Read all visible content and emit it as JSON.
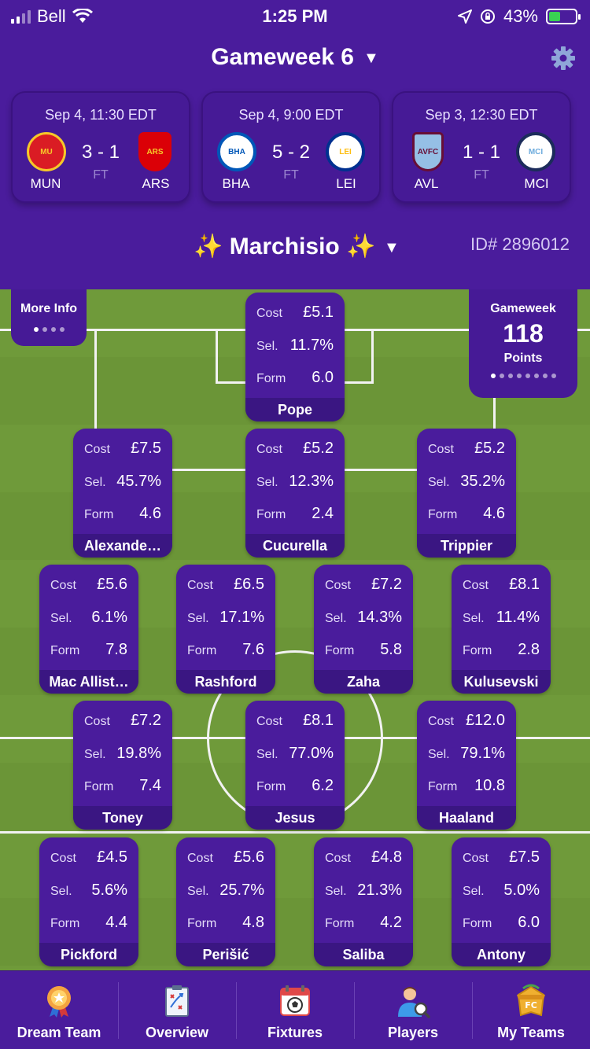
{
  "status_bar": {
    "carrier": "Bell",
    "time": "1:25 PM",
    "battery": "43%"
  },
  "header": {
    "title": "Gameweek 6"
  },
  "matches": [
    {
      "time": "Sep 4, 11:30 EDT",
      "home": "MUN",
      "away": "ARS",
      "score": "3 - 1",
      "status": "FT",
      "home_crest": "Manchester United",
      "away_crest": "Arsenal"
    },
    {
      "time": "Sep 4, 9:00 EDT",
      "home": "BHA",
      "away": "LEI",
      "score": "5 - 2",
      "status": "FT",
      "home_crest": "Brighton",
      "away_crest": "Leicester City"
    },
    {
      "time": "Sep 3, 12:30 EDT",
      "home": "AVL",
      "away": "MCI",
      "score": "1 - 1",
      "status": "FT",
      "home_crest": "AVFC",
      "away_crest": "Manchester City"
    }
  ],
  "team": {
    "name": "✨ Marchisio ✨",
    "id_label": "ID# 2896012"
  },
  "pitch": {
    "more_info": "More Info",
    "gw_label": "Gameweek",
    "points_value": "118",
    "points_label": "Points"
  },
  "labels": {
    "cost": "Cost",
    "sel": "Sel.",
    "form": "Form"
  },
  "players": [
    {
      "name": "Pope",
      "cost": "£5.1",
      "sel": "11.7%",
      "form": "6.0"
    },
    {
      "name": "Alexande…",
      "cost": "£7.5",
      "sel": "45.7%",
      "form": "4.6"
    },
    {
      "name": "Cucurella",
      "cost": "£5.2",
      "sel": "12.3%",
      "form": "2.4"
    },
    {
      "name": "Trippier",
      "cost": "£5.2",
      "sel": "35.2%",
      "form": "4.6"
    },
    {
      "name": "Mac Allist…",
      "cost": "£5.6",
      "sel": "6.1%",
      "form": "7.8"
    },
    {
      "name": "Rashford",
      "cost": "£6.5",
      "sel": "17.1%",
      "form": "7.6"
    },
    {
      "name": "Zaha",
      "cost": "£7.2",
      "sel": "14.3%",
      "form": "5.8"
    },
    {
      "name": "Kulusevski",
      "cost": "£8.1",
      "sel": "11.4%",
      "form": "2.8"
    },
    {
      "name": "Toney",
      "cost": "£7.2",
      "sel": "19.8%",
      "form": "7.4"
    },
    {
      "name": "Jesus",
      "cost": "£8.1",
      "sel": "77.0%",
      "form": "6.2"
    },
    {
      "name": "Haaland",
      "cost": "£12.0",
      "sel": "79.1%",
      "form": "10.8"
    },
    {
      "name": "Pickford",
      "cost": "£4.5",
      "sel": "5.6%",
      "form": "4.4"
    },
    {
      "name": "Perišić",
      "cost": "£5.6",
      "sel": "25.7%",
      "form": "4.8"
    },
    {
      "name": "Saliba",
      "cost": "£4.8",
      "sel": "21.3%",
      "form": "4.2"
    },
    {
      "name": "Antony",
      "cost": "£7.5",
      "sel": "5.0%",
      "form": "6.0"
    }
  ],
  "tabs": [
    {
      "label": "Dream Team",
      "icon": "medal-icon"
    },
    {
      "label": "Overview",
      "icon": "tactics-board-icon"
    },
    {
      "label": "Fixtures",
      "icon": "calendar-ball-icon"
    },
    {
      "label": "Players",
      "icon": "player-search-icon"
    },
    {
      "label": "My Teams",
      "icon": "team-badge-icon"
    }
  ],
  "colors": {
    "background": "#4a1c9c",
    "card": "#461a96",
    "name_bar": "#3a1682",
    "pitch": "#6f9a3a",
    "charging": "#39d353"
  }
}
